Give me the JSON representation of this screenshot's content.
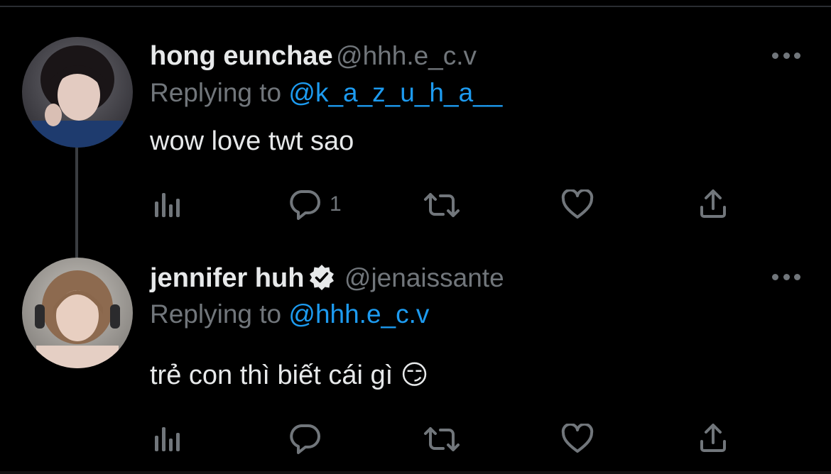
{
  "tweets": [
    {
      "name": "hong eunchae",
      "handle": "@hhh.e_c.v",
      "replying_prefix": "Replying to",
      "replying_to": "@k_a_z_u_h_a__",
      "text": "wow love twt sao",
      "verified": false,
      "reply_count": "1"
    },
    {
      "name": "jennifer huh",
      "handle": "@jenaissante",
      "replying_prefix": "Replying to",
      "replying_to": "@hhh.e_c.v",
      "text": "trẻ con thì biết cái gì",
      "emoji": "😏",
      "verified": true,
      "reply_count": ""
    }
  ],
  "icons": [
    "views-icon",
    "reply-icon",
    "retweet-icon",
    "like-icon",
    "share-icon",
    "more-icon",
    "verified-icon"
  ],
  "colors": {
    "background": "#000000",
    "text": "#e7e9ea",
    "secondary": "#71767b",
    "link": "#1d9bf0"
  }
}
